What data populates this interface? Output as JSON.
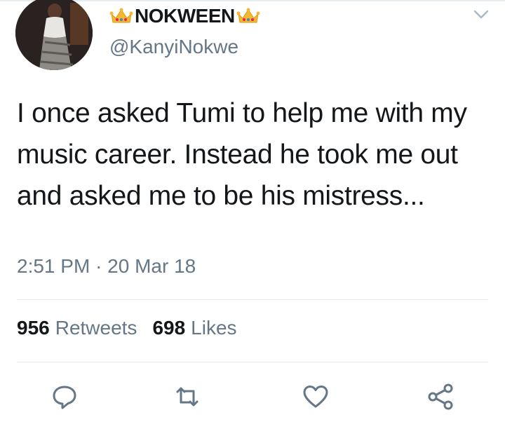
{
  "author": {
    "display_name": "NOKWEEN",
    "handle": "@KanyiNokwe",
    "name_decoration_icon": "crown-emoji"
  },
  "tweet": {
    "text": "I once asked Tumi to help me with my music career. Instead he took me out and asked me to be his mistress...",
    "time": "2:51 PM",
    "separator": "·",
    "date": "20 Mar 18"
  },
  "stats": {
    "retweets_count": "956",
    "retweets_label": "Retweets",
    "likes_count": "698",
    "likes_label": "Likes"
  },
  "actions": [
    {
      "name": "reply",
      "icon": "reply-icon"
    },
    {
      "name": "retweet",
      "icon": "retweet-icon"
    },
    {
      "name": "like",
      "icon": "heart-icon"
    },
    {
      "name": "share",
      "icon": "share-icon"
    }
  ],
  "colors": {
    "primary_text": "#14171a",
    "secondary_text": "#657786",
    "divider": "#e1e8ed",
    "crown_gold": "#f5b82e"
  }
}
